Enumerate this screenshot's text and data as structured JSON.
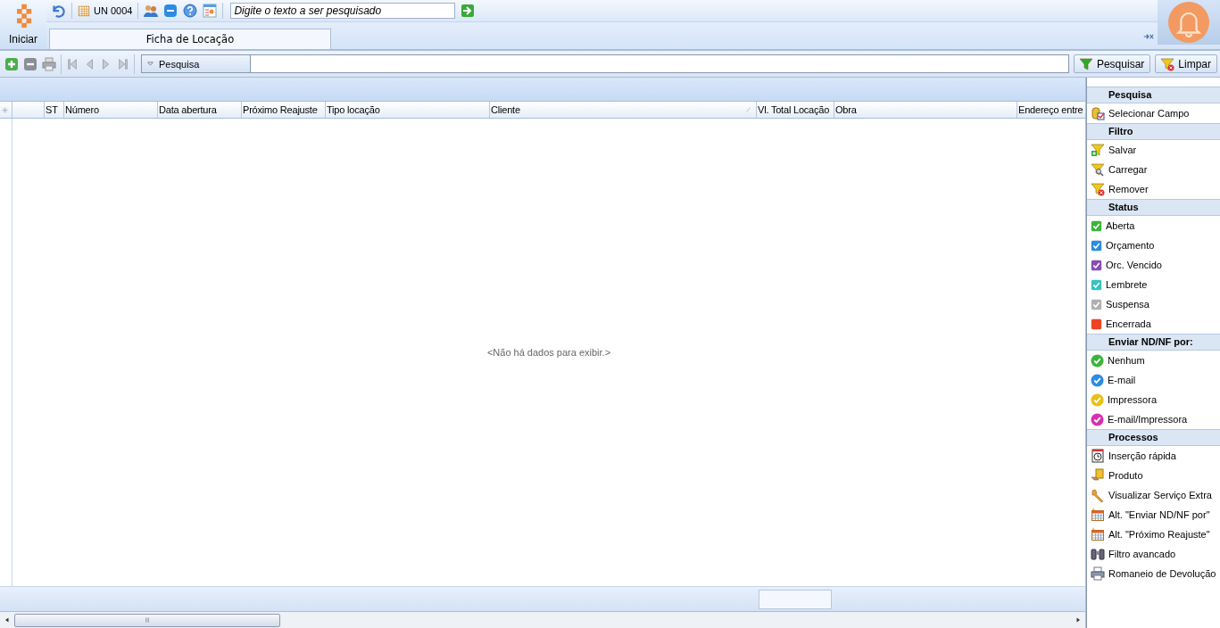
{
  "header": {
    "start_label": "Iniciar",
    "unit": "UN 0004",
    "search_placeholder": "Digite o texto a ser pesquisado"
  },
  "tabs": [
    {
      "label": "Ficha de Locação",
      "selected": true
    }
  ],
  "record_toolbar": {
    "search_mode": "Pesquisa",
    "search_button": "Pesquisar",
    "clear_button": "Limpar"
  },
  "table": {
    "columns": [
      {
        "label": "ST",
        "sorted": false
      },
      {
        "label": "Número",
        "sorted": false
      },
      {
        "label": "Data abertura",
        "sorted": false
      },
      {
        "label": "Próximo Reajuste",
        "sorted": false
      },
      {
        "label": "Tipo locação",
        "sorted": false
      },
      {
        "label": "Cliente",
        "sorted": true
      },
      {
        "label": "Vl. Total Locação",
        "sorted": false
      },
      {
        "label": "Obra",
        "sorted": false
      },
      {
        "label": "Endereço entre",
        "sorted": false
      }
    ],
    "empty_message": "<Não há dados para exibir.>"
  },
  "side_panel": {
    "sections": [
      {
        "title": "Pesquisa",
        "items": [
          {
            "label": "Selecionar Campo",
            "kind": "fieldpicker"
          }
        ]
      },
      {
        "title": "Filtro",
        "items": [
          {
            "label": "Salvar",
            "kind": "filtersave"
          },
          {
            "label": "Carregar",
            "kind": "filterload"
          },
          {
            "label": "Remover",
            "kind": "filterremove"
          }
        ]
      },
      {
        "title": "Status",
        "items": [
          {
            "label": "Aberta",
            "kind": "checkbox",
            "color": "#3cb43c"
          },
          {
            "label": "Orçamento",
            "kind": "checkbox",
            "color": "#2d8be0"
          },
          {
            "label": "Orc. Vencido",
            "kind": "checkbox",
            "color": "#8a4bb5"
          },
          {
            "label": "Lembrete",
            "kind": "checkbox",
            "color": "#35c2c2"
          },
          {
            "label": "Suspensa",
            "kind": "checkbox",
            "color": "#b0b0b0"
          },
          {
            "label": "Encerrada",
            "kind": "square",
            "color": "#ee4422"
          }
        ]
      },
      {
        "title": "Enviar ND/NF por:",
        "items": [
          {
            "label": "Nenhum",
            "kind": "bullet",
            "color": "#3cb43c"
          },
          {
            "label": "E-mail",
            "kind": "bullet",
            "color": "#2d8be0"
          },
          {
            "label": "Impressora",
            "kind": "bullet",
            "color": "#e8c012"
          },
          {
            "label": "E-mail/Impressora",
            "kind": "bullet",
            "color": "#d930b0"
          }
        ]
      },
      {
        "title": "Processos",
        "items": [
          {
            "label": "Inserção rápida",
            "kind": "clock"
          },
          {
            "label": "Produto",
            "kind": "box"
          },
          {
            "label": "Visualizar Serviço Extra",
            "kind": "wrench"
          },
          {
            "label": "Alt. \"Enviar ND/NF por\"",
            "kind": "calendar"
          },
          {
            "label": "Alt. \"Próximo Reajuste\"",
            "kind": "calendar"
          },
          {
            "label": "Filtro avancado",
            "kind": "binoculars"
          },
          {
            "label": "Romaneio de Devolução",
            "kind": "printer"
          }
        ]
      }
    ]
  }
}
